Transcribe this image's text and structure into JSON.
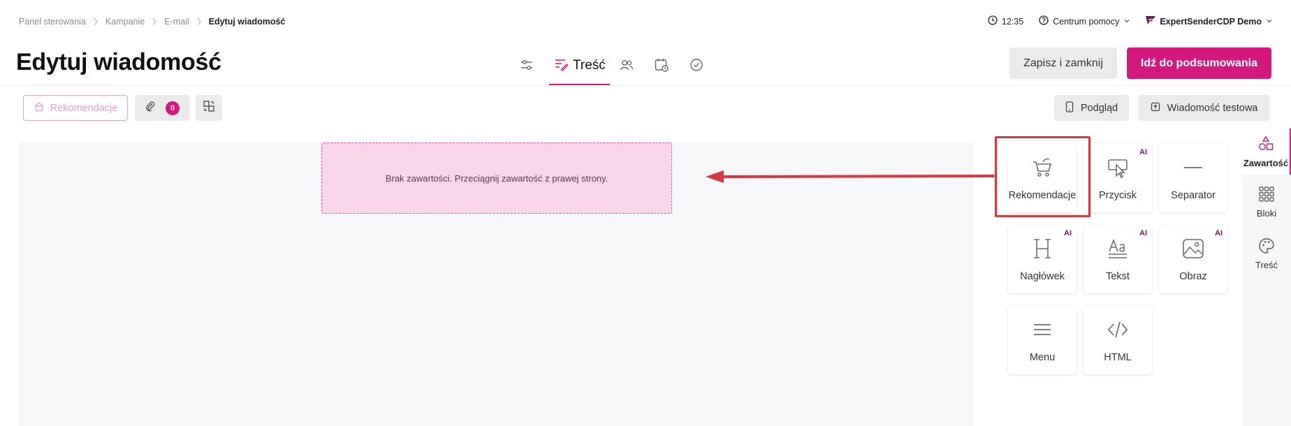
{
  "breadcrumb": [
    "Panel sterowania",
    "Kampanie",
    "E-mail",
    "Edytuj wiadomość"
  ],
  "topbar": {
    "time": "12:35",
    "help": "Centrum pomocy",
    "account": "ExpertSenderCDP Demo"
  },
  "header": {
    "title": "Edytuj wiadomość",
    "active_step": "Treść",
    "save_close": "Zapisz i zamknij",
    "go_summary": "Idź do podsumowania"
  },
  "toolbar": {
    "recommendations": "Rekomendacje",
    "attachments_count": "0",
    "preview": "Podgląd",
    "test_message": "Wiadomość testowa"
  },
  "canvas": {
    "empty_text": "Brak zawartości. Przeciągnij zawartość z prawej strony."
  },
  "tiles": [
    {
      "label": "Rekomendacje",
      "icon": "cart-icon",
      "ai": ""
    },
    {
      "label": "Przycisk",
      "icon": "button-cursor-icon",
      "ai": "AI"
    },
    {
      "label": "Separator",
      "icon": "line-icon",
      "ai": ""
    },
    {
      "label": "Nagłówek",
      "icon": "heading-icon",
      "ai": "AI"
    },
    {
      "label": "Tekst",
      "icon": "text-icon",
      "ai": "AI"
    },
    {
      "label": "Obraz",
      "icon": "image-icon",
      "ai": "AI"
    },
    {
      "label": "Menu",
      "icon": "menu-icon",
      "ai": ""
    },
    {
      "label": "HTML",
      "icon": "code-icon",
      "ai": ""
    }
  ],
  "sidebar": {
    "items": [
      {
        "label": "Zawartość",
        "icon": "shapes-icon"
      },
      {
        "label": "Bloki",
        "icon": "grid-icon"
      },
      {
        "label": "Treść",
        "icon": "palette-icon"
      }
    ]
  },
  "colors": {
    "accent": "#d3197f",
    "dropzone": "#fbd5e9",
    "annotation": "#d9373f"
  }
}
